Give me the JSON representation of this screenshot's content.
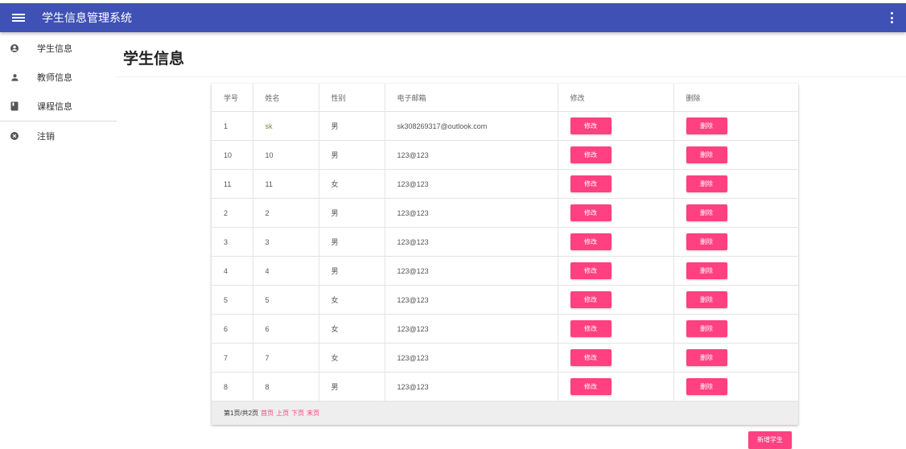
{
  "appbar": {
    "title": "学生信息管理系统"
  },
  "sidebar": {
    "items": [
      {
        "label": "学生信息",
        "icon": "account-circle-icon"
      },
      {
        "label": "教师信息",
        "icon": "person-icon"
      },
      {
        "label": "课程信息",
        "icon": "book-icon"
      },
      {
        "label": "注销",
        "icon": "cancel-circle-icon"
      }
    ]
  },
  "main": {
    "title": "学生信息"
  },
  "table": {
    "headers": [
      "学号",
      "姓名",
      "性别",
      "电子邮箱",
      "修改",
      "删除"
    ],
    "edit_label": "修改",
    "delete_label": "删除",
    "rows": [
      {
        "id": "1",
        "name": "sk",
        "gender": "男",
        "email": "sk308269317@outlook.com"
      },
      {
        "id": "10",
        "name": "10",
        "gender": "男",
        "email": "123@123"
      },
      {
        "id": "11",
        "name": "11",
        "gender": "女",
        "email": "123@123"
      },
      {
        "id": "2",
        "name": "2",
        "gender": "男",
        "email": "123@123"
      },
      {
        "id": "3",
        "name": "3",
        "gender": "男",
        "email": "123@123"
      },
      {
        "id": "4",
        "name": "4",
        "gender": "男",
        "email": "123@123"
      },
      {
        "id": "5",
        "name": "5",
        "gender": "女",
        "email": "123@123"
      },
      {
        "id": "6",
        "name": "6",
        "gender": "女",
        "email": "123@123"
      },
      {
        "id": "7",
        "name": "7",
        "gender": "女",
        "email": "123@123"
      },
      {
        "id": "8",
        "name": "8",
        "gender": "男",
        "email": "123@123"
      }
    ]
  },
  "pager": {
    "info": "第1页/共2页",
    "first": "首页",
    "prev": "上页",
    "next": "下页",
    "last": "末页"
  },
  "add_button": "新增学生",
  "colors": {
    "primary": "#3f51b5",
    "accent": "#ff4081"
  }
}
